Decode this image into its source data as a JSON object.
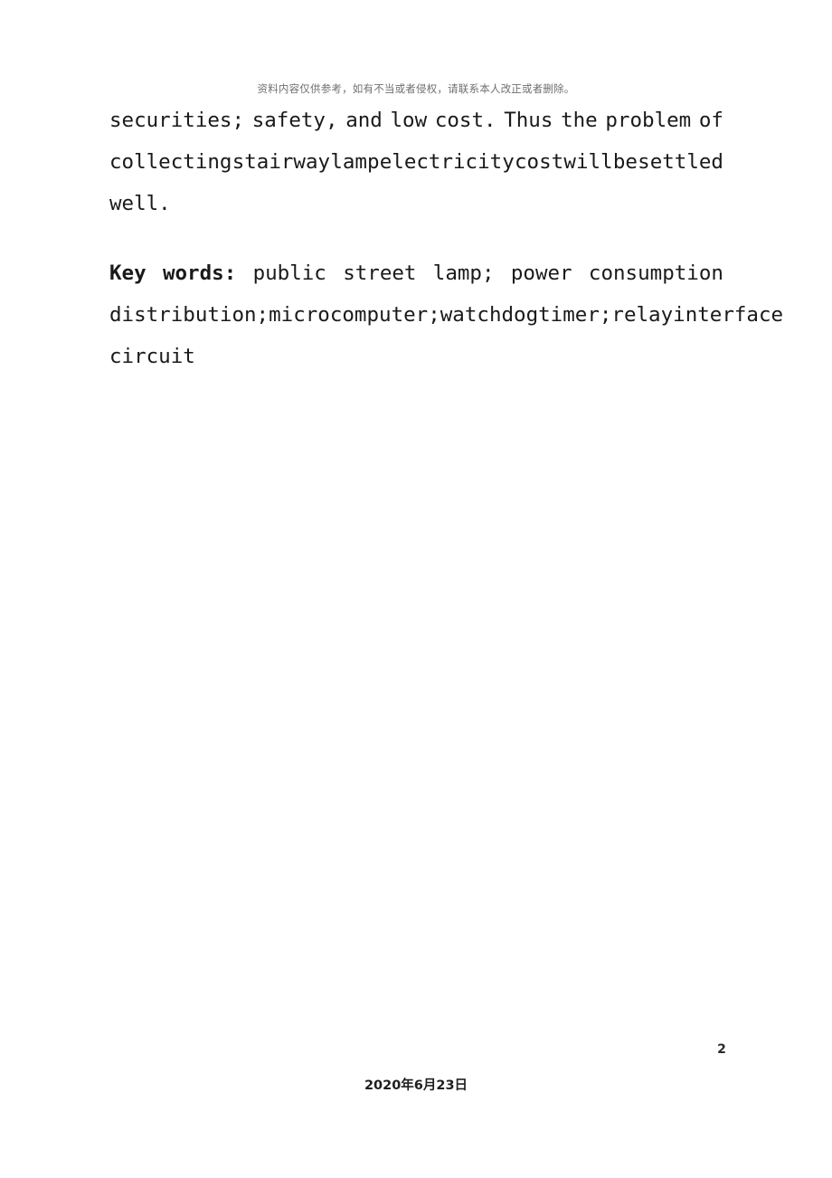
{
  "header": {
    "notice": "资料内容仅供参考，如有不当或者侵权，请联系本人改正或者删除。"
  },
  "body": {
    "paragraphs": [
      {
        "id": "abstract-tail",
        "lines": [
          {
            "justified": true,
            "words": [
              "securities;",
              "safety,",
              "and",
              "low",
              "cost.",
              "Thus",
              "the",
              "problem",
              "of"
            ]
          },
          {
            "justified": true,
            "words": [
              "collecting",
              "stairway",
              "lamp",
              "electricity",
              "cost",
              "will",
              "be",
              "settled"
            ]
          },
          {
            "justified": false,
            "text": "well."
          }
        ]
      },
      {
        "id": "keywords",
        "lines": [
          {
            "justified": true,
            "words": [
              "Key",
              "words:",
              "public",
              "street",
              "lamp;",
              "power",
              "consumption"
            ],
            "bold_until": 2
          },
          {
            "justified": true,
            "words": [
              "distribution;",
              "microcomputer;",
              "watchdog",
              "timer;",
              "relay",
              "interface"
            ]
          },
          {
            "justified": false,
            "text": "circuit"
          }
        ]
      }
    ]
  },
  "footer": {
    "page_number": "2",
    "date": "2020年6月23日"
  }
}
